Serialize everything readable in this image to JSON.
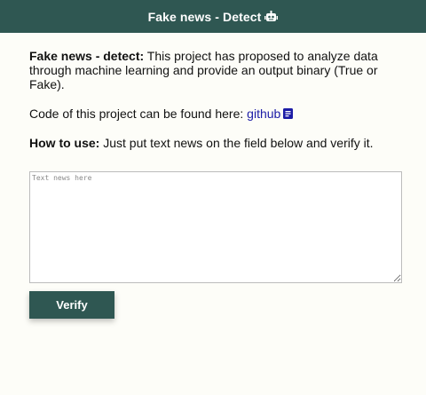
{
  "header": {
    "title": "Fake news - Detect",
    "icon": "robot-icon"
  },
  "intro": {
    "bold": "Fake news - detect:",
    "text": " This project has proposed to analyze data through machine learning and provide an output binary (True or Fake)."
  },
  "code": {
    "text": "Code of this project can be found here: ",
    "link_label": "github",
    "link_icon": "document-icon"
  },
  "howto": {
    "bold": "How to use:",
    "text": " Just put text news on the field below and verify it."
  },
  "form": {
    "placeholder": "Text news here",
    "value": "",
    "verify_label": "Verify"
  },
  "colors": {
    "header_bg": "#2f5752",
    "button_bg": "#2f5752",
    "link": "#1c1ca6"
  }
}
